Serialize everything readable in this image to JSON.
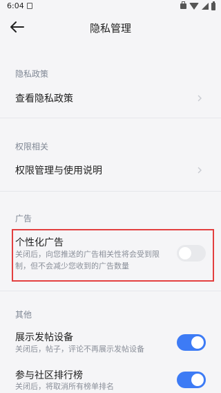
{
  "status_bar": {
    "time": "6:04",
    "icons": [
      "download-icon",
      "bag-icon",
      "wifi-icon",
      "signal-icon",
      "battery-icon"
    ]
  },
  "app_bar": {
    "title": "隐私管理",
    "back_icon": "arrow-left-icon"
  },
  "sections": {
    "privacy_policy": {
      "label": "隐私政策",
      "item": "查看隐私政策"
    },
    "permissions": {
      "label": "权限相关",
      "item": "权限管理与使用说明"
    },
    "ads": {
      "label": "广告",
      "item": "个性化广告",
      "desc_line1": "关闭后，向您推送的广告相关性将会受到限",
      "desc_line2": "制，但不会减少您收到的广告数量",
      "toggle": "off"
    },
    "other": {
      "label": "其他",
      "items": [
        {
          "title": "展示发帖设备",
          "desc": "关闭后，帖子，评论不再展示发帖设备",
          "toggle": "on"
        },
        {
          "title": "参与社区排行榜",
          "desc": "关闭后，将取消所有榜单排名",
          "toggle": "on"
        }
      ]
    }
  },
  "colors": {
    "accent": "#3d7bf5",
    "highlight_border": "#e33f3f",
    "background": "#f5f5f7"
  }
}
